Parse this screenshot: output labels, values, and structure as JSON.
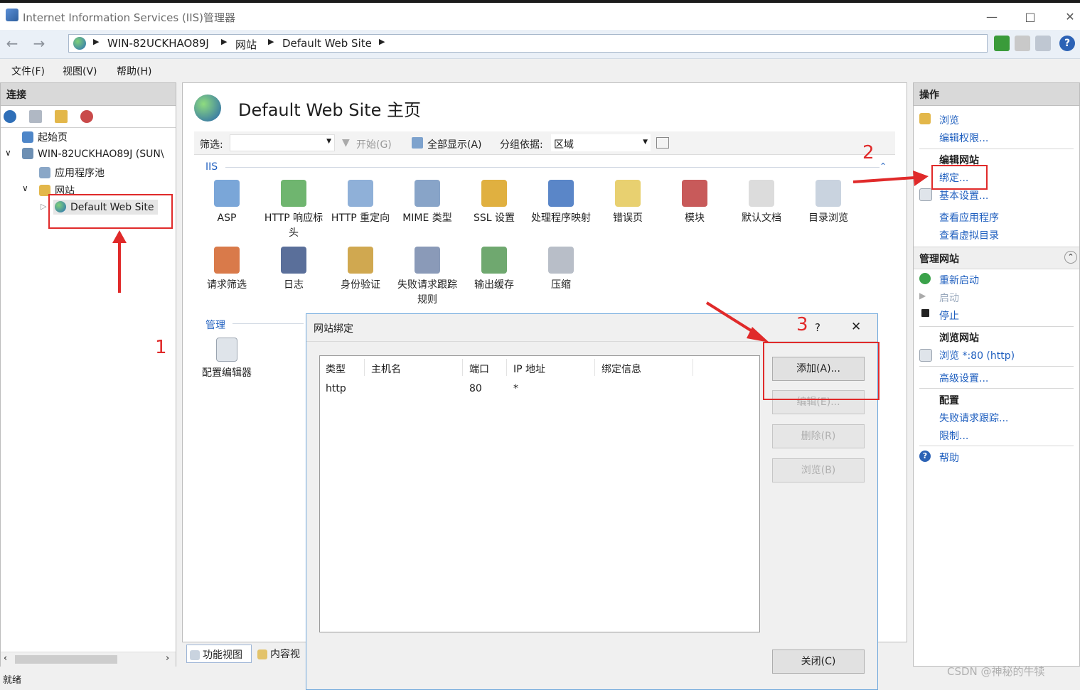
{
  "window": {
    "title": "Internet Information Services (IIS)管理器"
  },
  "breadcrumb": [
    "WIN-82UCKHAO89J",
    "网站",
    "Default Web Site"
  ],
  "menu": [
    "文件(F)",
    "视图(V)",
    "帮助(H)"
  ],
  "connections": {
    "header": "连接",
    "tree": {
      "start_page": "起始页",
      "server": "WIN-82UCKHAO89J (SUN\\",
      "app_pools": "应用程序池",
      "sites": "网站",
      "default_site": "Default Web Site"
    }
  },
  "center": {
    "title": "Default Web Site 主页",
    "filter_label": "筛选:",
    "go_label": "开始(G)",
    "show_all_label": "全部显示(A)",
    "group_by_label": "分组依据:",
    "group_by_value": "区域",
    "section_iis": "IIS",
    "features_row1": [
      "ASP",
      "HTTP 响应标头",
      "HTTP 重定向",
      "MIME 类型",
      "SSL 设置",
      "处理程序映射",
      "错误页",
      "模块",
      "默认文档",
      "目录浏览"
    ],
    "features_row2": [
      "请求筛选",
      "日志",
      "身份验证",
      "失败请求跟踪规则",
      "输出缓存",
      "压缩"
    ],
    "section_manage": "管理",
    "manage_features": [
      "配置编辑器"
    ],
    "bottom_tabs": [
      "功能视图",
      "内容视"
    ]
  },
  "actions": {
    "header": "操作",
    "browse": "浏览",
    "edit_permissions": "编辑权限...",
    "edit_site_group": "编辑网站",
    "bindings": "绑定...",
    "basic_settings": "基本设置...",
    "view_apps": "查看应用程序",
    "view_vdirs": "查看虚拟目录",
    "manage_site_group": "管理网站",
    "restart": "重新启动",
    "start": "启动",
    "stop": "停止",
    "browse_site_group": "浏览网站",
    "browse_80": "浏览 *:80 (http)",
    "advanced_settings": "高级设置...",
    "config_group": "配置",
    "failed_tracing": "失败请求跟踪...",
    "limits": "限制...",
    "help": "帮助"
  },
  "dialog": {
    "title": "网站绑定",
    "help": "?",
    "columns": [
      "类型",
      "主机名",
      "端口",
      "IP 地址",
      "绑定信息"
    ],
    "rows": [
      {
        "type": "http",
        "host": "",
        "port": "80",
        "ip": "*",
        "info": ""
      }
    ],
    "buttons": {
      "add": "添加(A)...",
      "edit": "编辑(E)...",
      "remove": "删除(R)",
      "browse": "浏览(B)",
      "close": "关闭(C)"
    }
  },
  "annotations": [
    "1",
    "2",
    "3"
  ],
  "status": "就绪",
  "watermark": "CSDN @神秘的牛犊",
  "colors": {
    "accent": "#1f5fbf",
    "annotation": "#e02a2a",
    "panel_header": "#d9d9d9"
  }
}
